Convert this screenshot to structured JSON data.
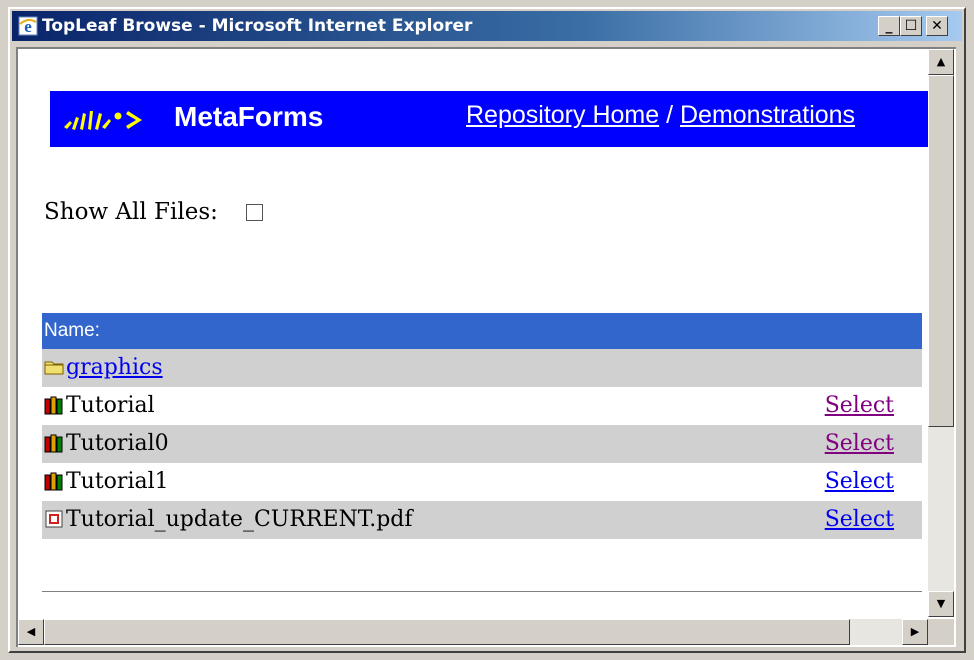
{
  "window": {
    "title": "TopLeaf Browse - Microsoft Internet Explorer",
    "icon": "ie-icon"
  },
  "title_buttons": {
    "minimize": "_",
    "maximize": "☐",
    "close": "✕"
  },
  "banner": {
    "brand": "MetaForms",
    "logo_icon": "metaforms-logo-icon",
    "nav_home": "Repository Home",
    "nav_separator": " / ",
    "nav_demos": "Demonstrations",
    "background": "#0000ff"
  },
  "filter": {
    "label": "Show All Files:",
    "checked": false
  },
  "table": {
    "header": "Name:",
    "header_color": "#3366cc",
    "rows": [
      {
        "name": "graphics",
        "icon": "folder-icon",
        "is_link": true,
        "select": ""
      },
      {
        "name": "Tutorial",
        "icon": "books-icon",
        "is_link": false,
        "select": "Select",
        "select_visited": true
      },
      {
        "name": "Tutorial0",
        "icon": "books-icon",
        "is_link": false,
        "select": "Select",
        "select_visited": true
      },
      {
        "name": "Tutorial1",
        "icon": "books-icon",
        "is_link": false,
        "select": "Select",
        "select_visited": false
      },
      {
        "name": "Tutorial_update_CURRENT.pdf",
        "icon": "pdf-icon",
        "is_link": false,
        "select": "Select",
        "select_visited": false
      }
    ]
  },
  "scroll_arrows": {
    "up": "▲",
    "down": "▼",
    "left": "◀",
    "right": "▶"
  }
}
